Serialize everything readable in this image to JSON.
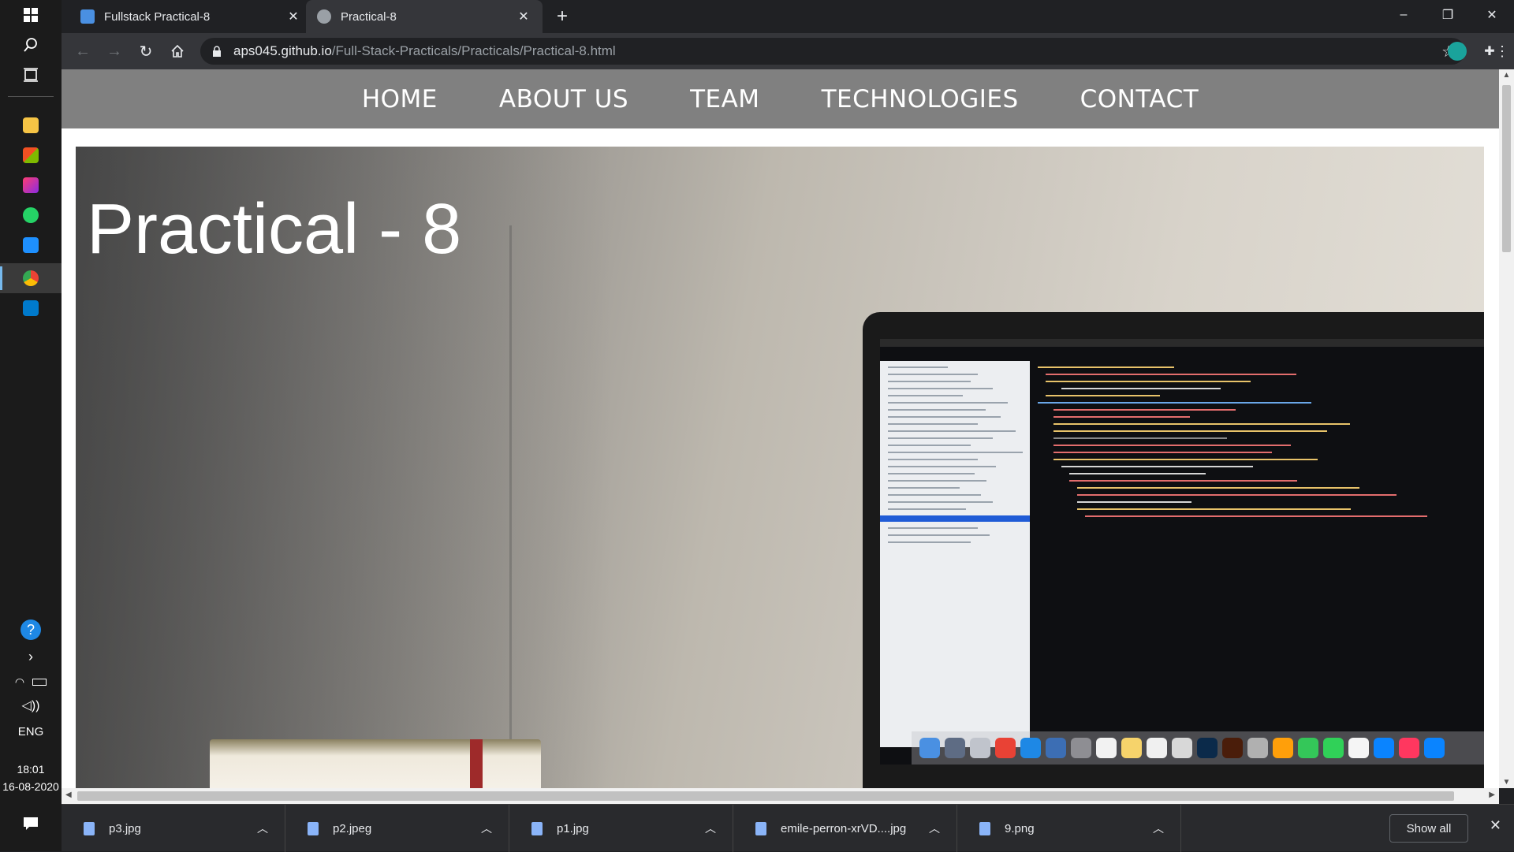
{
  "taskbar": {
    "language": "ENG",
    "time": "18:01",
    "date": "16-08-2020",
    "apps": [
      "file-explorer-icon",
      "store-icon",
      "app-icon",
      "whatsapp-icon",
      "app-icon-2",
      "chrome-icon",
      "vscode-icon"
    ]
  },
  "browser": {
    "tabs": [
      {
        "title": "Fullstack Practical-8",
        "active": false
      },
      {
        "title": "Practical-8",
        "active": true
      }
    ],
    "url_host": "aps045.github.io",
    "url_path": "/Full-Stack-Practicals/Practicals/Practical-8.html"
  },
  "page": {
    "nav": [
      "HOME",
      "ABOUT US",
      "TEAM",
      "TECHNOLOGIES",
      "CONTACT"
    ],
    "hero_title": "Practical - 8"
  },
  "downloads": {
    "items": [
      "p3.jpg",
      "p2.jpeg",
      "p1.jpg",
      "emile-perron-xrVD....jpg",
      "9.png"
    ],
    "show_all": "Show all"
  },
  "colors": {
    "nav_bg": "#808080",
    "browser_dark": "#202124",
    "toolbar": "#35363a"
  }
}
